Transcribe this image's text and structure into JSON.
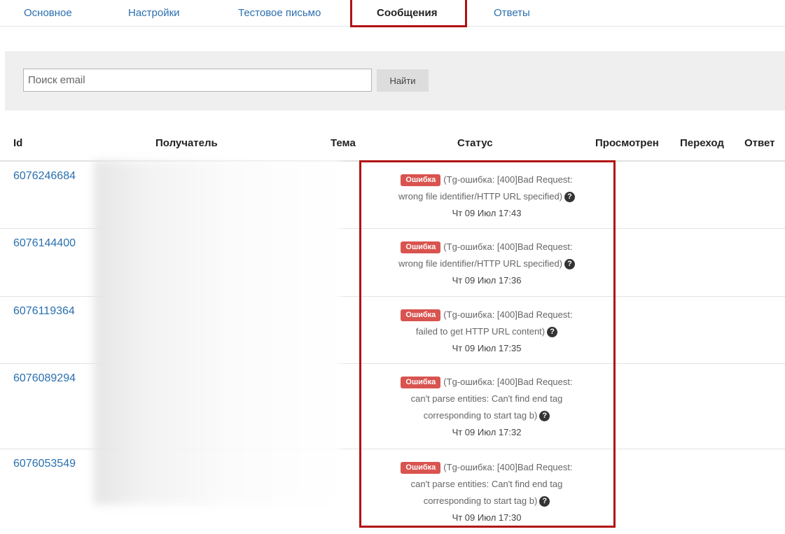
{
  "tabs": [
    {
      "label": "Основное"
    },
    {
      "label": "Настройки"
    },
    {
      "label": "Тестовое письмо"
    },
    {
      "label": "Сообщения"
    },
    {
      "label": "Ответы"
    }
  ],
  "active_tab": "Сообщения",
  "search": {
    "placeholder": "Поиск email",
    "value": "",
    "button_label": "Найти"
  },
  "table": {
    "columns": [
      "Id",
      "Получатель",
      "Тема",
      "Статус",
      "Просмотрен",
      "Переход",
      "Ответ"
    ],
    "rows": [
      {
        "id": "6076246684",
        "badge": "Ошибка",
        "lines": [
          "(Tg-ошибка: [400]Bad Request:",
          "wrong file identifier/HTTP URL specified)"
        ],
        "date": "Чт 09 Июл 17:43"
      },
      {
        "id": "6076144400",
        "badge": "Ошибка",
        "lines": [
          "(Tg-ошибка: [400]Bad Request:",
          "wrong file identifier/HTTP URL specified)"
        ],
        "date": "Чт 09 Июл 17:36"
      },
      {
        "id": "6076119364",
        "badge": "Ошибка",
        "lines": [
          "(Tg-ошибка: [400]Bad Request:",
          "failed to get HTTP URL content)"
        ],
        "date": "Чт 09 Июл 17:35"
      },
      {
        "id": "6076089294",
        "badge": "Ошибка",
        "lines": [
          "(Tg-ошибка: [400]Bad Request:",
          "can't parse entities: Can't find end tag",
          "corresponding to start tag b)"
        ],
        "date": "Чт 09 Июл 17:32"
      },
      {
        "id": "6076053549",
        "badge": "Ошибка",
        "lines": [
          "(Tg-ошибка: [400]Bad Request:",
          "can't parse entities: Can't find end tag",
          "corresponding to start tag b)"
        ],
        "date": "Чт 09 Июл 17:30"
      }
    ]
  },
  "colors": {
    "link": "#2a6faf",
    "badge": "#d9534f",
    "highlight": "#b11212",
    "panel": "#efefef"
  },
  "icons": {
    "help": "question-circle-icon"
  }
}
